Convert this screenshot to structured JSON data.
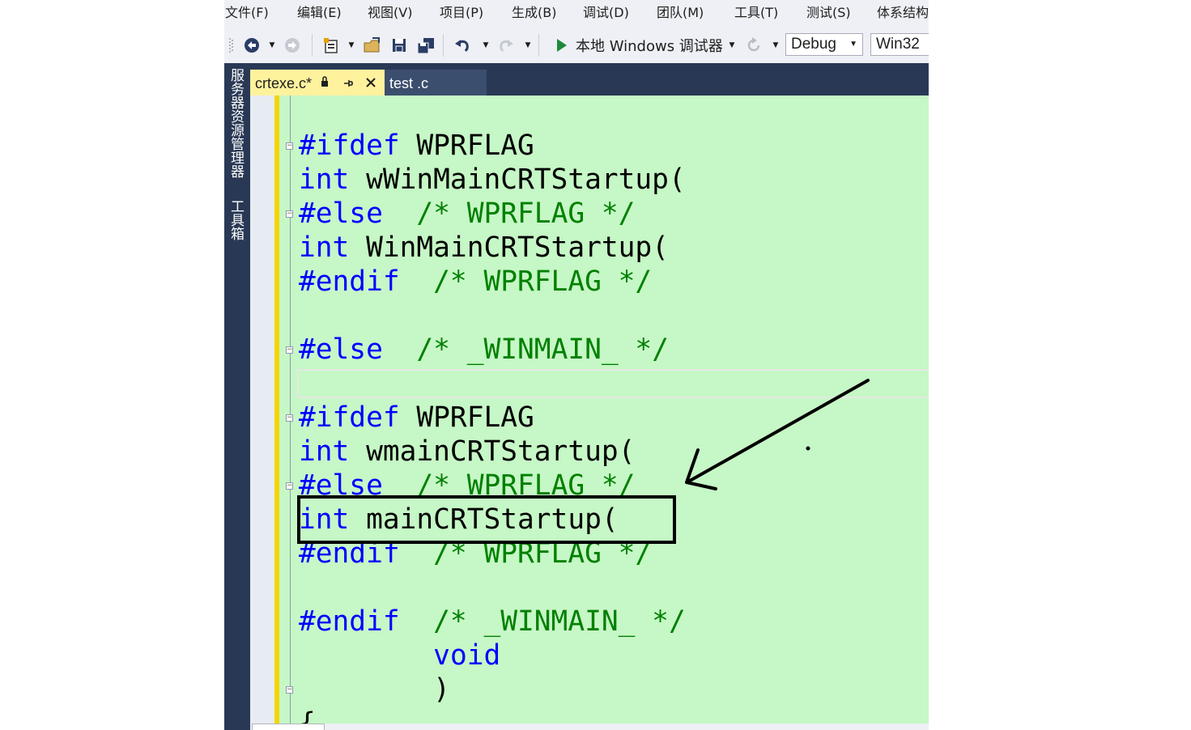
{
  "menu": {
    "items": [
      "文件(F)",
      "编辑(E)",
      "视图(V)",
      "项目(P)",
      "生成(B)",
      "调试(D)",
      "团队(M)",
      "工具(T)",
      "测试(S)",
      "体系结构"
    ]
  },
  "toolbar": {
    "debugger_label": "本地 Windows 调试器",
    "configuration": "Debug",
    "platform": "Win32"
  },
  "side_panels": [
    "服务器资源管理器",
    "工具箱"
  ],
  "tabs": [
    {
      "label": "crtexe.c*",
      "active": true
    },
    {
      "label": "test .c",
      "active": false
    }
  ],
  "code": {
    "line1": {
      "kw": "#ifdef",
      "rest": " WPRFLAG"
    },
    "line2": {
      "kw": "int",
      "rest": " wWinMainCRTStartup("
    },
    "line3": {
      "kw": "#else",
      "comment": "  /* WPRFLAG */"
    },
    "line4": {
      "kw": "int",
      "rest": " WinMainCRTStartup("
    },
    "line5": {
      "kw": "#endif",
      "comment": "  /* WPRFLAG */"
    },
    "line7": {
      "kw": "#else",
      "comment": "  /* _WINMAIN_ */"
    },
    "line9": {
      "kw": "#ifdef",
      "rest": " WPRFLAG"
    },
    "line10": {
      "kw": "int",
      "rest": " wmainCRTStartup("
    },
    "line11": {
      "kw": "#else",
      "comment": "  /* WPRFLAG */"
    },
    "line12": {
      "kw": "int",
      "rest": " mainCRTStartup("
    },
    "line13": {
      "kw": "#endif",
      "comment": "  /* WPRFLAG */"
    },
    "line15": {
      "kw": "#endif",
      "comment": "  /* _WINMAIN_ */"
    },
    "line16": {
      "indent": "        ",
      "kw": "void"
    },
    "line17": {
      "indent": "        ",
      "rest": ")"
    },
    "line18": {
      "rest": "{"
    }
  },
  "colors": {
    "editor_bg": "#c6f7c6",
    "keyword": "#0000ff",
    "comment": "#008000",
    "active_tab": "#fff29d",
    "chrome_dark": "#293955",
    "change_bar": "#f3d400"
  }
}
